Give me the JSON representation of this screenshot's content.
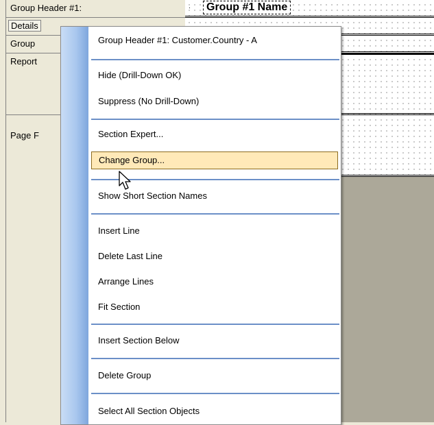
{
  "sections": [
    {
      "label": "Group Header #1:"
    },
    {
      "label": "Details"
    },
    {
      "label": "Group"
    },
    {
      "label": "Report"
    },
    {
      "label": "Page F"
    }
  ],
  "canvas": {
    "group_field": "Group #1 Name",
    "bullet": "."
  },
  "menu": {
    "items": [
      {
        "label": "Group Header #1: Customer.Country - A"
      },
      {
        "label": "Hide (Drill-Down OK)"
      },
      {
        "label": "Suppress (No Drill-Down)"
      },
      {
        "label": "Section Expert..."
      },
      {
        "label": "Change Group...",
        "highlighted": true
      },
      {
        "label": "Show Short Section Names"
      },
      {
        "label": "Insert Line"
      },
      {
        "label": "Delete Last Line"
      },
      {
        "label": "Arrange Lines"
      },
      {
        "label": "Fit Section"
      },
      {
        "label": "Insert Section Below"
      },
      {
        "label": "Delete Group"
      },
      {
        "label": "Select All Section Objects"
      }
    ]
  },
  "icons": {
    "cursor": "mouse-pointer-icon"
  },
  "colors": {
    "menu_strip": "#a9c7ee",
    "highlight_bg": "#ffe9b8",
    "highlight_border": "#8c6a1e",
    "separator": "#6b8fc7",
    "canvas_bg": "#aca899"
  }
}
